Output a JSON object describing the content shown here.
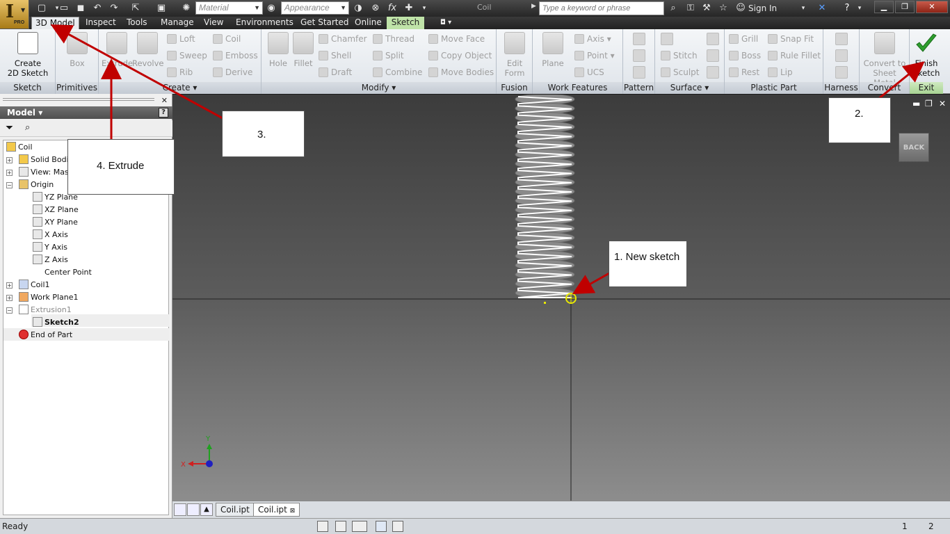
{
  "app": {
    "pro_label": "PRO",
    "doc_title": "Coil"
  },
  "quickaccess": {
    "material_placeholder": "Material",
    "appearance_placeholder": "Appearance",
    "fx": "fx"
  },
  "search": {
    "placeholder": "Type a keyword or phrase"
  },
  "account": {
    "sign_in": "Sign In"
  },
  "tabs": [
    {
      "label": "3D Model"
    },
    {
      "label": "Inspect"
    },
    {
      "label": "Tools"
    },
    {
      "label": "Manage"
    },
    {
      "label": "View"
    },
    {
      "label": "Environments"
    },
    {
      "label": "Get Started"
    },
    {
      "label": "Online"
    },
    {
      "label": "Sketch"
    }
  ],
  "ribbon": {
    "sketch_panel": {
      "title": "Sketch",
      "create_line1": "Create",
      "create_line2": "2D Sketch"
    },
    "primitives_panel": {
      "title": "Primitives",
      "box": "Box"
    },
    "create_panel": {
      "title": "Create",
      "extrude": "Extrude",
      "revolve": "Revolve",
      "loft": "Loft",
      "sweep": "Sweep",
      "rib": "Rib",
      "coil": "Coil",
      "emboss": "Emboss",
      "derive": "Derive"
    },
    "modify_panel": {
      "title": "Modify",
      "hole": "Hole",
      "fillet": "Fillet",
      "chamfer": "Chamfer",
      "shell": "Shell",
      "draft": "Draft",
      "thread": "Thread",
      "split": "Split",
      "combine": "Combine",
      "move_face": "Move Face",
      "copy_object": "Copy Object",
      "move_bodies": "Move Bodies"
    },
    "fusion_panel": {
      "title": "Fusion",
      "edit_line1": "Edit",
      "edit_line2": "Form"
    },
    "work_panel": {
      "title": "Work Features",
      "plane": "Plane",
      "axis": "Axis",
      "point": "Point",
      "ucs": "UCS"
    },
    "pattern_panel": {
      "title": "Pattern"
    },
    "surface_panel": {
      "title": "Surface",
      "stitch": "Stitch",
      "sculpt": "Sculpt"
    },
    "plastic_panel": {
      "title": "Plastic Part",
      "grill": "Grill",
      "boss": "Boss",
      "rest": "Rest",
      "snap_fit": "Snap Fit",
      "rule_fillet": "Rule Fillet",
      "lip": "Lip"
    },
    "harness_panel": {
      "title": "Harness"
    },
    "convert_panel": {
      "title": "Convert",
      "line1": "Convert to",
      "line2": "Sheet Metal"
    },
    "exit_panel": {
      "title": "Exit",
      "finish_line1": "Finish",
      "finish_line2": "Sketch"
    }
  },
  "browser": {
    "title": "Model",
    "help": "?",
    "tree": [
      {
        "label": "Coil"
      },
      {
        "label": "Solid Bodies(1)"
      },
      {
        "label": "View: Master"
      },
      {
        "label": "Origin"
      },
      {
        "label": "YZ Plane"
      },
      {
        "label": "XZ Plane"
      },
      {
        "label": "XY Plane"
      },
      {
        "label": "X Axis"
      },
      {
        "label": "Y Axis"
      },
      {
        "label": "Z Axis"
      },
      {
        "label": "Center Point"
      },
      {
        "label": "Coil1"
      },
      {
        "label": "Work Plane1"
      },
      {
        "label": "Extrusion1"
      },
      {
        "label": "Sketch2"
      },
      {
        "label": "End of Part"
      }
    ]
  },
  "viewport": {
    "back_label": "BACK",
    "triad_x": "X",
    "triad_y": "Y"
  },
  "doc_tabs": [
    {
      "label": "Coil.ipt"
    },
    {
      "label": "Coil.ipt"
    }
  ],
  "status": {
    "text": "Ready",
    "count1": "1",
    "count2": "2"
  },
  "annotations": {
    "n1": "1. New sketch",
    "n2": "2.",
    "n3": "3.",
    "n4": "4. Extrude"
  },
  "colors": {
    "arrow": "#c00000",
    "finish_green": "#2e9e2e",
    "sketch_tab": "#bfe3a8",
    "select_yellow": "#e8e800"
  }
}
